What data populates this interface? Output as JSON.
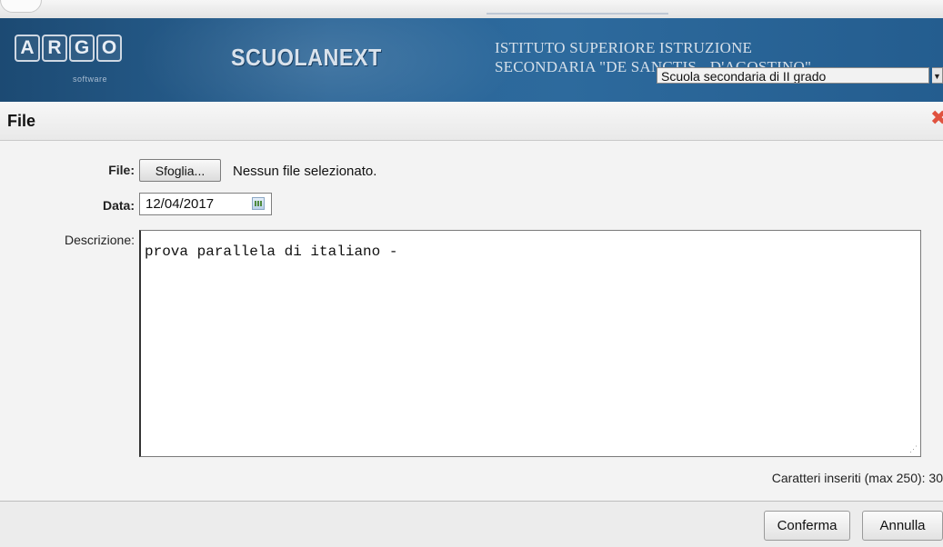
{
  "banner": {
    "logo_letters": [
      "A",
      "R",
      "G",
      "O"
    ],
    "logo_subtitle": "software",
    "app_name": "SCUOLANEXT",
    "school_name_line1": "ISTITUTO SUPERIORE ISTRUZIONE",
    "school_name_line2": "SECONDARIA \"DE SANCTIS - D'AGOSTINO\"",
    "school_type_selected": "Scuola secondaria di II grado"
  },
  "dialog": {
    "title": "File",
    "close_icon": "close-icon"
  },
  "form": {
    "file_label": "File:",
    "browse_button_label": "Sfoglia...",
    "file_status": "Nessun file selezionato.",
    "date_label": "Data:",
    "date_value": "12/04/2017",
    "calendar_icon": "calendar-icon",
    "description_label": "Descrizione:",
    "description_value": "prova parallela di italiano -",
    "char_count": "Caratteri inseriti (max 250): 30"
  },
  "footer": {
    "confirm_label": "Conferma",
    "cancel_label": "Annulla"
  },
  "colors": {
    "banner": "#2b6597",
    "close_icon": "#e0523f"
  }
}
